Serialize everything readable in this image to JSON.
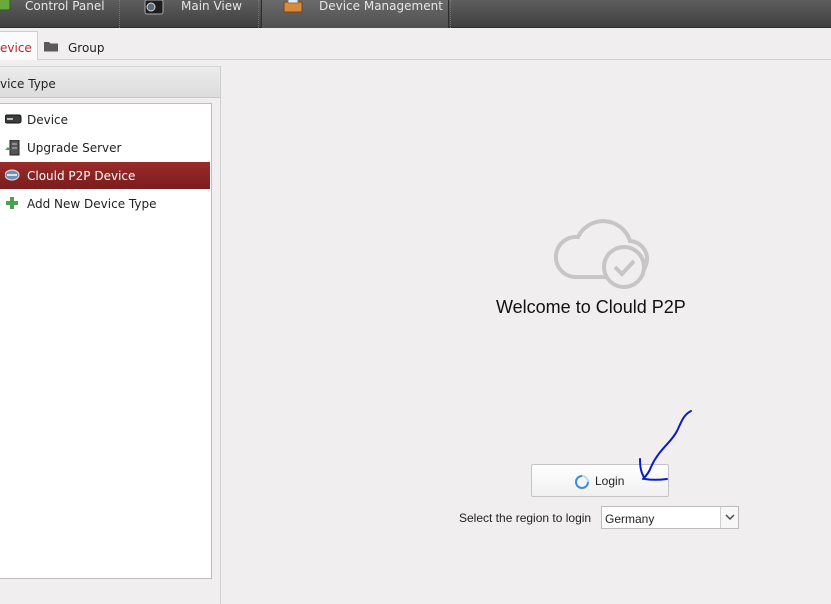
{
  "top_tabs": [
    {
      "label": "Control Panel",
      "icon": "control-panel-icon"
    },
    {
      "label": "Main View",
      "icon": "main-view-icon"
    },
    {
      "label": "Device Management",
      "icon": "device-management-icon",
      "active": true
    }
  ],
  "sub_tabs": [
    {
      "label": "evice",
      "active": true
    },
    {
      "label": "Group",
      "icon": "folder-icon"
    }
  ],
  "left_panel": {
    "header": "vice Type",
    "items": [
      {
        "label": "Device",
        "icon": "dvr-icon"
      },
      {
        "label": "Upgrade Server",
        "icon": "server-icon"
      },
      {
        "label": "Clould P2P Device",
        "icon": "cloud-device-icon",
        "selected": true
      },
      {
        "label": "Add New Device Type",
        "icon": "plus-icon"
      }
    ]
  },
  "main": {
    "welcome": "Welcome to Clould P2P",
    "login_label": "Login",
    "region_label": "Select the region to login",
    "region_value": "Germany"
  },
  "colors": {
    "accent_red": "#8b2323",
    "topbar": "#4a4a4a",
    "background": "#f0eeee"
  }
}
